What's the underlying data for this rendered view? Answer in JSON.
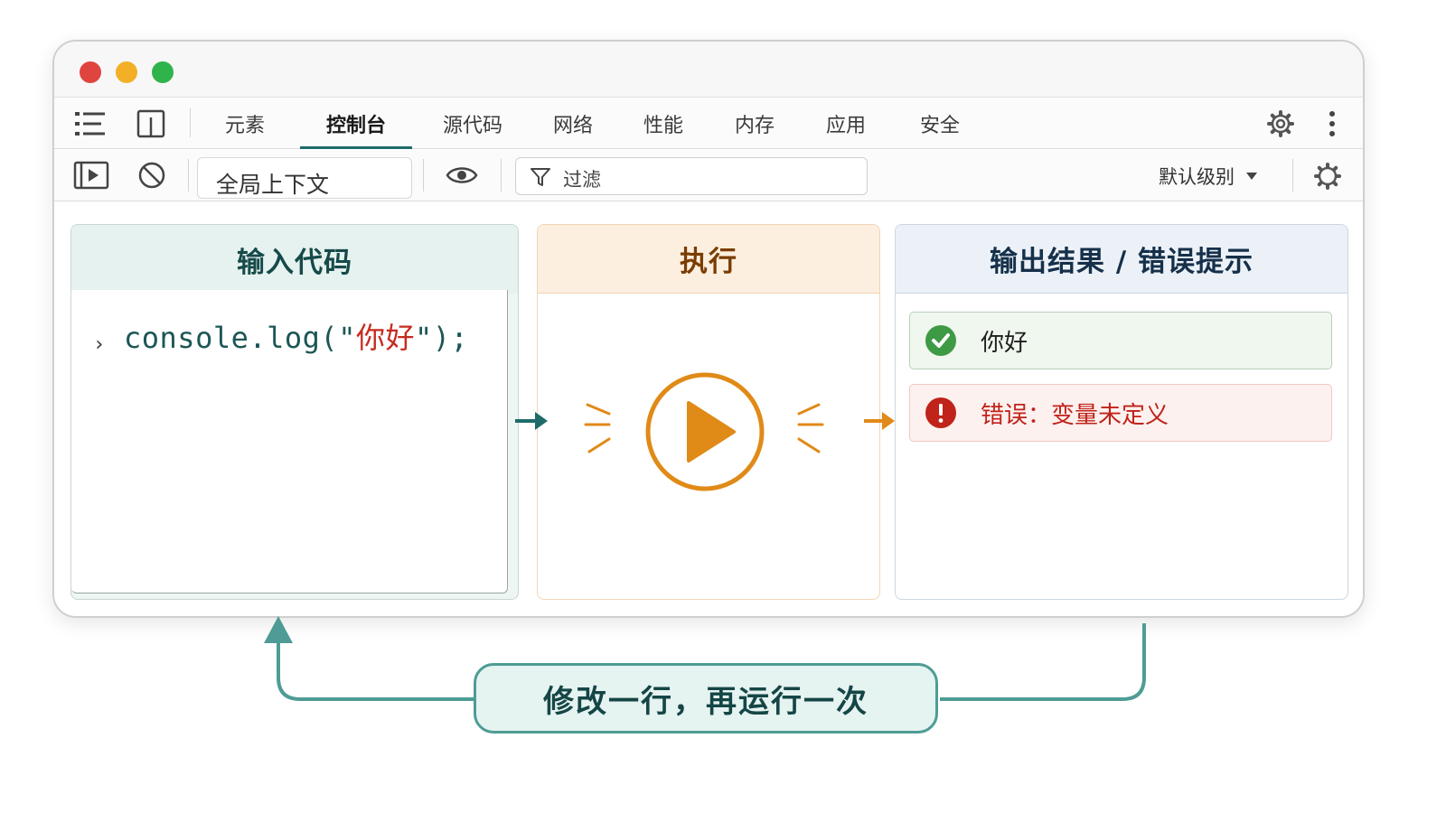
{
  "window": {
    "traffic_lights": {
      "close_color": "#e0443e",
      "minimize_color": "#f3b026",
      "zoom_color": "#2fb34b"
    }
  },
  "devtools": {
    "tabs": [
      {
        "label": "元素",
        "active": false
      },
      {
        "label": "控制台",
        "active": true
      },
      {
        "label": "源代码",
        "active": false
      },
      {
        "label": "网络",
        "active": false
      },
      {
        "label": "性能",
        "active": false
      },
      {
        "label": "内存",
        "active": false
      },
      {
        "label": "应用",
        "active": false
      },
      {
        "label": "安全",
        "active": false
      }
    ],
    "tab_icons": [
      "list-icon",
      "dock-panel-icon"
    ],
    "tab_right_icons": [
      "settings-gear-icon",
      "more-vertical-icon"
    ],
    "accent_color": "#1f6b6b"
  },
  "console_toolbar": {
    "context": "全局上下文",
    "filter_placeholder": "过滤",
    "level": "默认级别",
    "icons": [
      "sidebar-play-icon",
      "clear-console-icon",
      "eye-icon",
      "filter-icon",
      "settings-gear-icon"
    ]
  },
  "panels": {
    "input": {
      "title": "输入代码",
      "prompt": "›",
      "code_before": "console.log(\"",
      "code_string": "你好",
      "code_after": "\");",
      "color": "#1d5656"
    },
    "exec": {
      "title": "执行",
      "icon": "play-circle-icon",
      "color": "#e08a17"
    },
    "output": {
      "title": "输出结果 / 错误提示",
      "success_message": "你好",
      "error_message": "错误：变量未定义",
      "success_color": "#3f9a45",
      "error_color": "#c0231a"
    }
  },
  "loop": {
    "caption": "修改一行，再运行一次",
    "color": "#4e9c95"
  }
}
